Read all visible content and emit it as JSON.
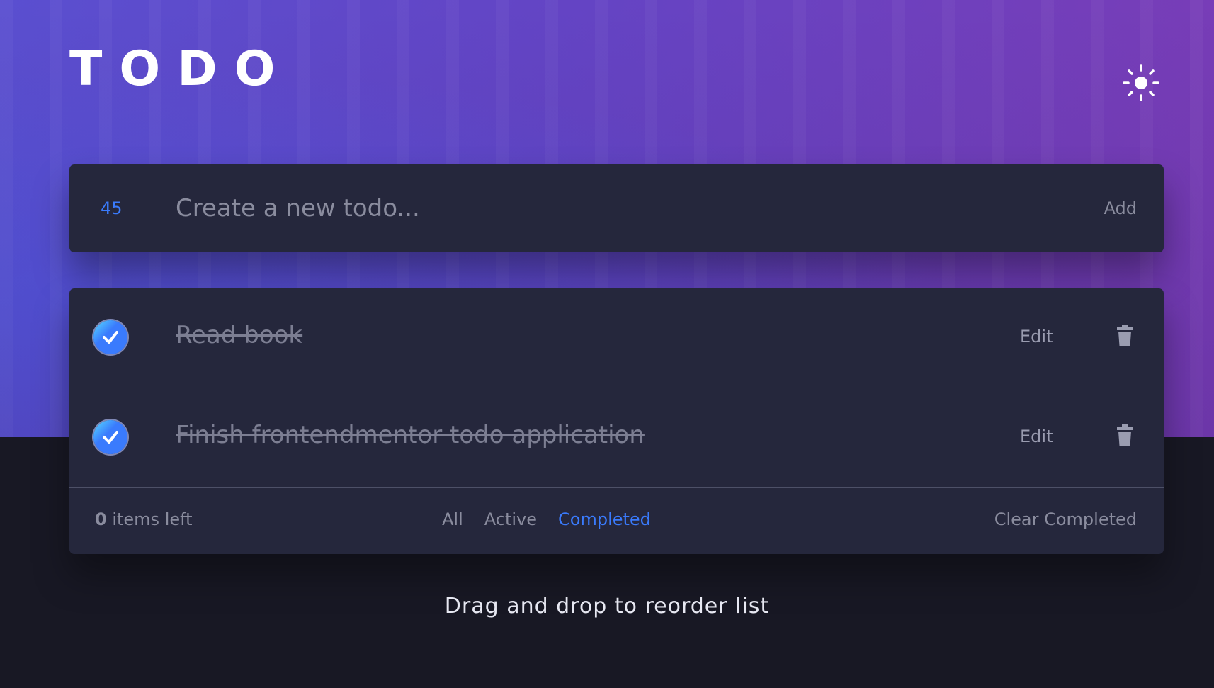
{
  "header": {
    "title": "TODO"
  },
  "icons": {
    "theme_toggle": "sun-icon",
    "check": "check-icon",
    "delete": "trash-icon"
  },
  "new_todo": {
    "counter": "45",
    "placeholder": "Create a new todo...",
    "add_label": "Add"
  },
  "todos": [
    {
      "text": "Read book",
      "completed": true,
      "edit_label": "Edit"
    },
    {
      "text": "Finish frontendmentor todo application",
      "completed": true,
      "edit_label": "Edit"
    }
  ],
  "footer": {
    "items_left_count": "0",
    "items_left_label": " items left",
    "filters": [
      {
        "label": "All",
        "active": false
      },
      {
        "label": "Active",
        "active": false
      },
      {
        "label": "Completed",
        "active": true
      }
    ],
    "clear_label": "Clear Completed"
  },
  "hint": "Drag and drop to reorder list",
  "colors": {
    "accent": "#3a7bfd",
    "panel": "#25273c",
    "background": "#181824"
  }
}
